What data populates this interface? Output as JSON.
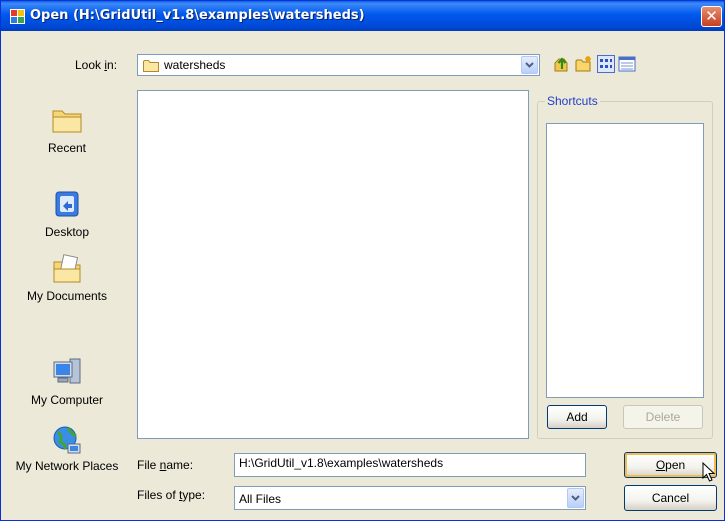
{
  "window": {
    "title": "Open (H:\\GridUtil_v1.8\\examples\\watersheds)",
    "close_icon": "close-icon"
  },
  "look_in": {
    "label_pre": "Look ",
    "label_key": "i",
    "label_post": "n:",
    "value": "watersheds",
    "icon": "folder-icon"
  },
  "toolbar": {
    "icons": [
      "up-one-level-icon",
      "new-folder-icon",
      "list-view-icon",
      "details-view-icon"
    ]
  },
  "places": [
    {
      "label": "Recent",
      "icon": "recent-folder-icon"
    },
    {
      "label": "Desktop",
      "icon": "desktop-icon"
    },
    {
      "label": "My Documents",
      "icon": "my-documents-icon"
    },
    {
      "label": "My Computer",
      "icon": "my-computer-icon"
    },
    {
      "label": "My Network Places",
      "icon": "network-places-icon"
    }
  ],
  "shortcuts": {
    "title": "Shortcuts",
    "add_label": "Add",
    "delete_label": "Delete"
  },
  "file_name": {
    "label_pre": "File ",
    "label_key": "n",
    "label_post": "ame:",
    "value": "H:\\GridUtil_v1.8\\examples\\watersheds"
  },
  "file_type": {
    "label_pre": "Files of ",
    "label_key": "t",
    "label_post": "ype:",
    "value": "All Files"
  },
  "buttons": {
    "open_key": "O",
    "open_rest": "pen",
    "cancel_label": "Cancel"
  },
  "colors": {
    "titlebar": "#0058ee",
    "dialog_bg": "#ece9d8",
    "shortcuts_title": "#1f3fc9"
  }
}
